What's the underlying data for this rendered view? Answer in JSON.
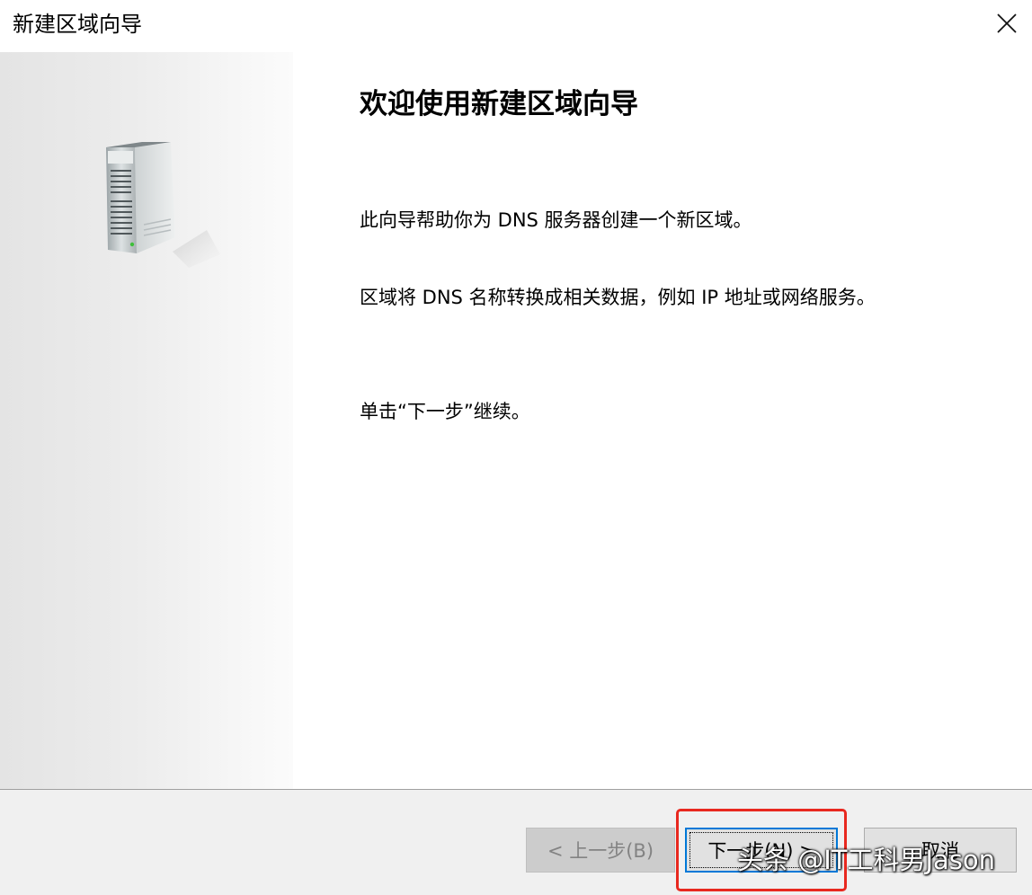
{
  "window": {
    "title": "新建区域向导",
    "close_icon": "close-icon"
  },
  "side_panel": {
    "icon": "server-tower-icon"
  },
  "content": {
    "heading": "欢迎使用新建区域向导",
    "paragraph1": "此向导帮助你为 DNS 服务器创建一个新区域。",
    "paragraph2": "区域将 DNS 名称转换成相关数据，例如 IP 地址或网络服务。",
    "paragraph3": "单击“下一步”继续。"
  },
  "footer": {
    "back_label": "< 上一步(B)",
    "next_label": "下一步(N) >",
    "cancel_label": "取消"
  },
  "overlay": {
    "highlight_color": "#e8281f",
    "watermark_text": "头条 @IT工科男Jason"
  }
}
